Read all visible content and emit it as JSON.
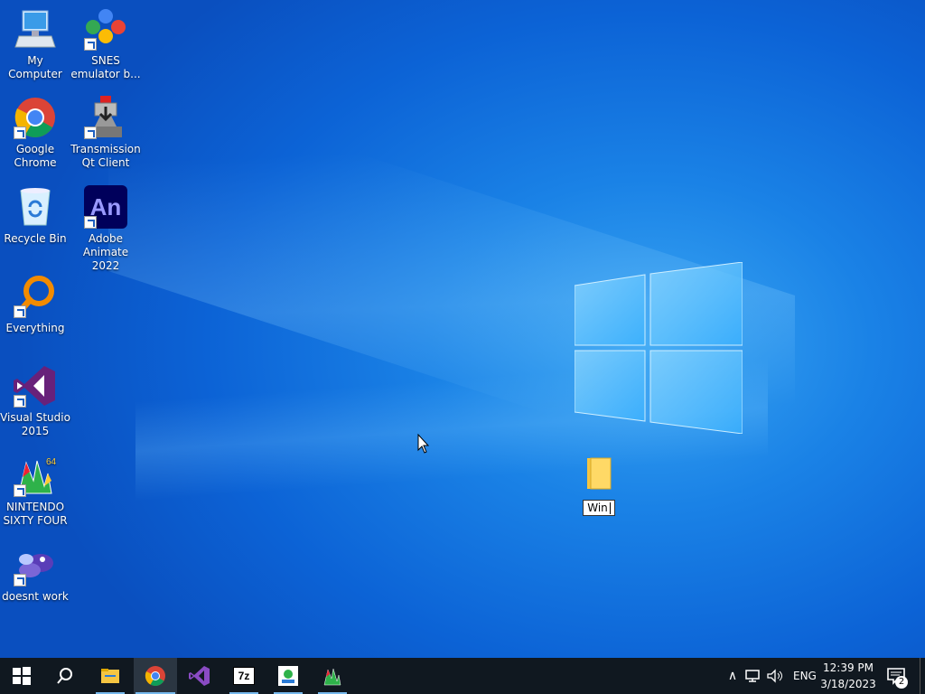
{
  "desktop": {
    "icons": [
      {
        "label": "My Computer"
      },
      {
        "label": "SNES emulator b..."
      },
      {
        "label": "Google Chrome"
      },
      {
        "label": "Transmission Qt Client"
      },
      {
        "label": "Recycle Bin"
      },
      {
        "label": "Adobe Animate 2022"
      },
      {
        "label": "Everything"
      },
      {
        "label": "Visual Studio 2015"
      },
      {
        "label": "NINTENDO SIXTY FOUR"
      },
      {
        "label": "doesnt work"
      }
    ],
    "rename_text": "Win",
    "animate_logo_text": "An"
  },
  "taskbar": {
    "apps": [
      {
        "icon": "start-icon"
      },
      {
        "icon": "search-icon"
      },
      {
        "icon": "file-explorer-icon"
      },
      {
        "icon": "chrome-icon",
        "active": true
      },
      {
        "icon": "visual-studio-icon"
      },
      {
        "icon": "7zip-icon",
        "text": "7z"
      },
      {
        "icon": "app-icon"
      },
      {
        "icon": "project64-icon"
      }
    ],
    "language": "ENG",
    "time": "12:39 PM",
    "date": "3/18/2023",
    "notification_count": "2"
  }
}
